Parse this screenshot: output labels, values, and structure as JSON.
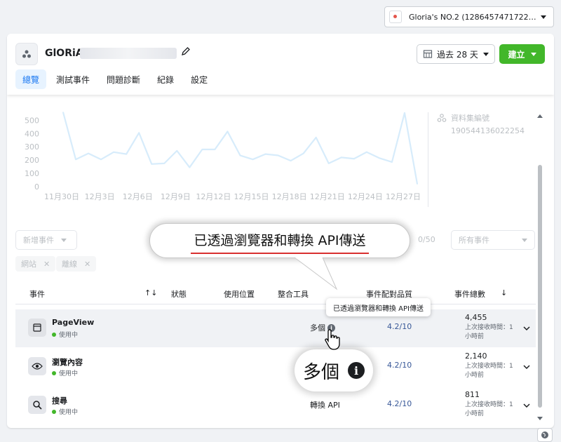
{
  "account": {
    "name": "Gloria's NO.2 (128645747172237..."
  },
  "header": {
    "pixel_name": "GlORiA",
    "date_range": "過去 28 天",
    "create_label": "建立",
    "tabs": [
      {
        "label": "總覽",
        "active": true
      },
      {
        "label": "測試事件",
        "active": false
      },
      {
        "label": "問題診斷",
        "active": false
      },
      {
        "label": "紀錄",
        "active": false
      },
      {
        "label": "設定",
        "active": false
      }
    ]
  },
  "dataset": {
    "label": "資料集編號",
    "id": "190544136022254"
  },
  "chart_data": {
    "type": "line",
    "x": [
      "11月30日",
      "12月1日",
      "12月2日",
      "12月3日",
      "12月4日",
      "12月5日",
      "12月6日",
      "12月7日",
      "12月8日",
      "12月9日",
      "12月10日",
      "12月11日",
      "12月12日",
      "12月13日",
      "12月14日",
      "12月15日",
      "12月16日",
      "12月17日",
      "12月18日",
      "12月19日",
      "12月20日",
      "12月21日",
      "12月22日",
      "12月23日",
      "12月24日",
      "12月25日",
      "12月26日",
      "12月27日",
      "12月28日"
    ],
    "x_tick_labels": [
      "11月30日",
      "12月3日",
      "12月6日",
      "12月9日",
      "12月12日",
      "12月15日",
      "12月18日",
      "12月21日",
      "12月24日",
      "12月27日"
    ],
    "values": [
      560,
      205,
      250,
      205,
      260,
      245,
      405,
      170,
      175,
      270,
      145,
      280,
      280,
      415,
      235,
      205,
      245,
      235,
      195,
      250,
      370,
      175,
      220,
      210,
      260,
      215,
      185,
      555,
      20
    ],
    "yticks": [
      0,
      100,
      200,
      300,
      400,
      500
    ],
    "ylim": [
      0,
      560
    ],
    "color": "#d7ecfb",
    "grid": false
  },
  "filters": {
    "add_event": "新增事件",
    "counter": "0/50",
    "all_events": "所有事件",
    "chips": [
      "網站",
      "離線"
    ]
  },
  "table": {
    "columns": {
      "event": "事件",
      "status": "狀態",
      "usage": "使用位置",
      "integration": "整合工具",
      "quality": "事件配對品質",
      "total": "事件總數"
    },
    "rows": [
      {
        "name": "PageView",
        "status": "使用中",
        "tool": "多個",
        "quality": "4.2/10",
        "count": "4,455",
        "sub": "上次接收時間：1 小時前"
      },
      {
        "name": "瀏覽內容",
        "status": "使用中",
        "tool": "",
        "quality": "4.2/10",
        "count": "2,140",
        "sub": "上次接收時間：1 小時前"
      },
      {
        "name": "搜尋",
        "status": "使用中",
        "tool": "轉換 API",
        "quality": "4.2/10",
        "count": "811",
        "sub": "上次接收時間：1 小時前"
      }
    ]
  },
  "tooltip": "已透過瀏覽器和轉換 API傳送",
  "callout": {
    "text": "已透過瀏覽器和轉換 API傳送"
  },
  "zoom": {
    "text": "多個"
  },
  "colors": {
    "brand": "#1877f2",
    "create": "#42b72a",
    "active_dot": "#42b72a"
  }
}
